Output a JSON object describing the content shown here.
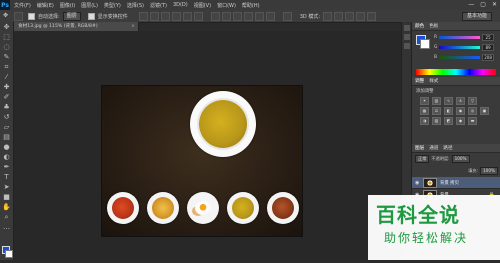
{
  "app": {
    "logo_text": "Ps"
  },
  "menubar": {
    "items": [
      "文件(F)",
      "编辑(E)",
      "图像(I)",
      "图层(L)",
      "类型(Y)",
      "选择(S)",
      "滤镜(T)",
      "3D(D)",
      "视图(V)",
      "窗口(W)",
      "帮助(H)"
    ]
  },
  "window_controls": {
    "minimize": "—",
    "maximize": "▢",
    "close": "✕"
  },
  "options_bar": {
    "auto_select_label": "自动选择:",
    "auto_select_value": "图层",
    "transform_label": "显示变换控件",
    "workspace_button": "基本功能"
  },
  "document": {
    "tab_title": "食材13.jpg @ 115% (背景, RGB/8#)",
    "close": "×"
  },
  "panels": {
    "color": {
      "tab_active": "颜色",
      "tab_other": "色板",
      "r_label": "R",
      "g_label": "G",
      "b_label": "B",
      "r_value": "25",
      "g_value": "89",
      "b_value": "208",
      "fg_color": "#1b4fd6",
      "bg_color": "#ffffff"
    },
    "adjustments": {
      "tab_active": "调整",
      "tab_other": "样式",
      "title": "添加调整"
    },
    "layers": {
      "tab_active": "图层",
      "tab_other": "通道",
      "tab_other2": "路径",
      "blend_mode": "正常",
      "opacity_label": "不透明度:",
      "opacity_value": "100%",
      "fill_label": "填充:",
      "fill_value": "100%",
      "rows": [
        {
          "name": "背景 拷贝"
        },
        {
          "name": "背景"
        }
      ]
    }
  },
  "watermark": {
    "title": "百科全说",
    "subtitle": "助你轻松解决"
  }
}
